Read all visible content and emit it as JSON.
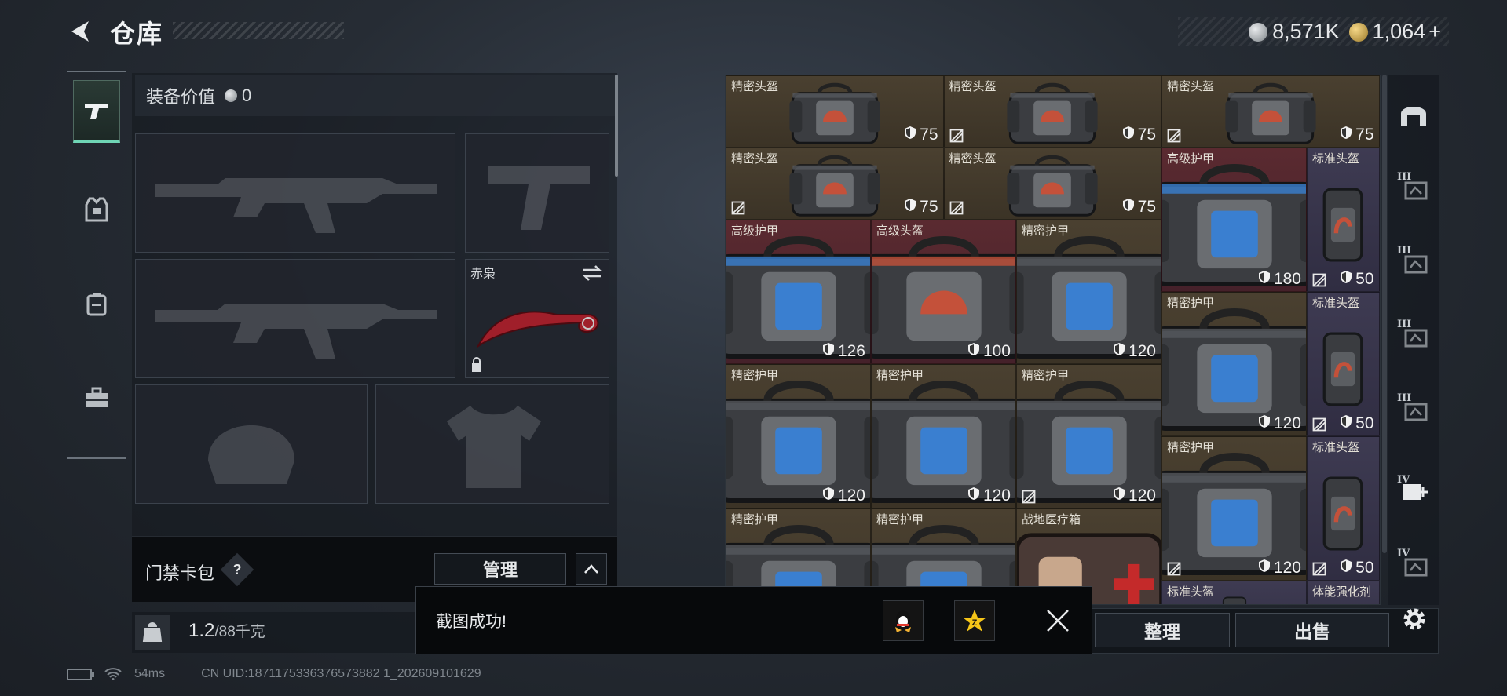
{
  "header": {
    "title": "仓库",
    "currency_silver": "8,571K",
    "currency_gold": "1,064",
    "plus": "+"
  },
  "left_tabs": [
    {
      "name": "weapons",
      "active": true
    },
    {
      "name": "armor",
      "active": false
    },
    {
      "name": "backpack",
      "active": false
    },
    {
      "name": "toolbox",
      "active": false
    }
  ],
  "loadout": {
    "value_label": "装备价值",
    "value": "0",
    "melee_label": "赤枭",
    "card_pack_label": "门禁卡包",
    "help": "?",
    "manage_label": "管理",
    "weight_value": "1.2",
    "weight_max": "/88千克"
  },
  "stash": {
    "cells": [
      {
        "name": "精密头盔",
        "stat": "75",
        "bg": "brown",
        "locked": false,
        "kind": "helmet"
      },
      {
        "name": "精密头盔",
        "stat": "75",
        "bg": "brown",
        "locked": true,
        "kind": "helmet"
      },
      {
        "name": "精密头盔",
        "stat": "75",
        "bg": "brown",
        "locked": true,
        "kind": "helmet"
      },
      {
        "name": "精密头盔",
        "stat": "75",
        "bg": "brown",
        "locked": true,
        "kind": "helmet"
      },
      {
        "name": "精密头盔",
        "stat": "75",
        "bg": "brown",
        "locked": true,
        "kind": "helmet"
      },
      {
        "name": "高级护甲",
        "stat": "180",
        "bg": "red",
        "locked": false,
        "kind": "armor-blue"
      },
      {
        "name": "标准头盔",
        "stat": "50",
        "bg": "purple",
        "locked": true,
        "kind": "helmet-small"
      },
      {
        "name": "高级护甲",
        "stat": "126",
        "bg": "red",
        "locked": false,
        "kind": "armor-blue"
      },
      {
        "name": "高级头盔",
        "stat": "100",
        "bg": "red",
        "locked": false,
        "kind": "helmet-red"
      },
      {
        "name": "精密护甲",
        "stat": "120",
        "bg": "brown",
        "locked": false,
        "kind": "armor"
      },
      {
        "name": "精密护甲",
        "stat": "120",
        "bg": "brown",
        "locked": false,
        "kind": "armor"
      },
      {
        "name": "标准头盔",
        "stat": "50",
        "bg": "purple",
        "locked": true,
        "kind": "helmet-small"
      },
      {
        "name": "精密护甲",
        "stat": "120",
        "bg": "brown",
        "locked": false,
        "kind": "armor"
      },
      {
        "name": "精密护甲",
        "stat": "120",
        "bg": "brown",
        "locked": false,
        "kind": "armor"
      },
      {
        "name": "精密护甲",
        "stat": "120",
        "bg": "brown",
        "locked": true,
        "kind": "armor"
      },
      {
        "name": "精密护甲",
        "stat": "120",
        "bg": "brown",
        "locked": true,
        "kind": "armor"
      },
      {
        "name": "标准头盔",
        "stat": "50",
        "bg": "purple",
        "locked": true,
        "kind": "helmet-small"
      },
      {
        "name": "精密护甲",
        "stat": "",
        "bg": "brown",
        "locked": false,
        "kind": "armor"
      },
      {
        "name": "精密护甲",
        "stat": "",
        "bg": "brown",
        "locked": false,
        "kind": "armor"
      },
      {
        "name": "战地医疗箱",
        "stat": "",
        "bg": "brown",
        "locked": false,
        "kind": "medkit"
      },
      {
        "name": "标准头盔",
        "stat": "",
        "bg": "purple",
        "locked": false,
        "kind": "helmet-small"
      },
      {
        "name": "体能强化剂",
        "stat": "",
        "bg": "purple",
        "locked": false,
        "kind": "none"
      }
    ]
  },
  "filters": [
    {
      "tier": "",
      "icon": "helmet-filter-icon"
    },
    {
      "tier": "III",
      "icon": "tier3-helmet-icon"
    },
    {
      "tier": "III",
      "icon": "tier3-vest-icon"
    },
    {
      "tier": "III",
      "icon": "tier3-vest-alt-icon"
    },
    {
      "tier": "III",
      "icon": "tier3-vest-b-icon"
    },
    {
      "tier": "IV",
      "icon": "tier4-plus-icon"
    },
    {
      "tier": "IV",
      "icon": "tier4-icon"
    }
  ],
  "actions": {
    "sort_label": "整理",
    "sell_label": "出售"
  },
  "toast": {
    "message": "截图成功!"
  },
  "status": {
    "ping": "54ms",
    "uid": "CN UID:1871175336376573882 1_202609101629"
  },
  "colors": {
    "accent": "#6fd5b5",
    "cell_brown": "#4a4030",
    "cell_red": "#5a2a30",
    "cell_purple": "#3e3b52",
    "armor_blue": "#3a7fd0",
    "helmet_red": "#c4513a"
  }
}
